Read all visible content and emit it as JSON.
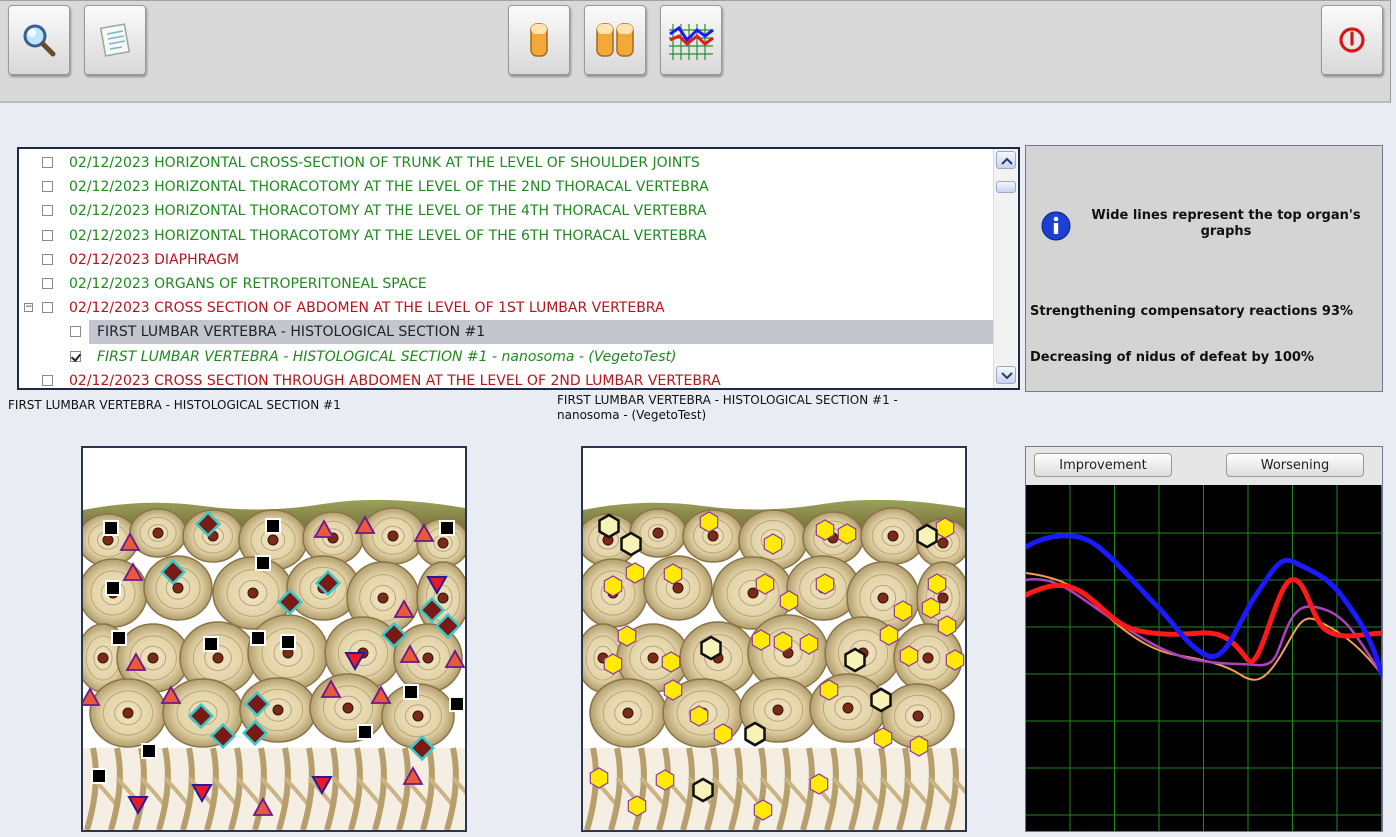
{
  "toolbar": {
    "buttons": [
      {
        "name": "search-button",
        "icon": "magnifier-icon"
      },
      {
        "name": "notes-button",
        "icon": "notebook-icon"
      },
      {
        "name": "single-view-button",
        "icon": "single-capsule-icon"
      },
      {
        "name": "compare-view-button",
        "icon": "double-capsule-icon"
      },
      {
        "name": "graph-view-button",
        "icon": "line-graph-icon"
      },
      {
        "name": "power-button",
        "icon": "power-icon"
      }
    ]
  },
  "list": {
    "rows": [
      {
        "text": "02/12/2023  HORIZONTAL CROSS-SECTION OF TRUNK AT THE LEVEL OF SHOULDER JOINTS",
        "color": "green",
        "checked": false
      },
      {
        "text": "02/12/2023  HORIZONTAL THORACOTOMY AT THE LEVEL OF THE 2ND THORACAL VERTEBRA",
        "color": "green",
        "checked": false
      },
      {
        "text": "02/12/2023  HORIZONTAL THORACOTOMY AT THE LEVEL OF THE 4TH THORACAL VERTEBRA",
        "color": "green",
        "checked": false
      },
      {
        "text": "02/12/2023  HORIZONTAL THORACOTOMY AT THE LEVEL OF THE 6TH THORACAL VERTEBRA",
        "color": "green",
        "checked": false
      },
      {
        "text": "02/12/2023  DIAPHRAGM",
        "color": "red",
        "checked": false
      },
      {
        "text": "02/12/2023  ORGANS OF RETROPERITONEAL SPACE",
        "color": "green",
        "checked": false
      },
      {
        "text": "02/12/2023  CROSS SECTION OF ABDOMEN AT THE LEVEL OF 1ST LUMBAR VERTEBRA",
        "color": "red",
        "checked": false
      },
      {
        "text": "FIRST LUMBAR VERTEBRA - HISTOLOGICAL SECTION #1",
        "color": "dark",
        "checked": false
      },
      {
        "text": "FIRST LUMBAR VERTEBRA - HISTOLOGICAL SECTION #1 - nanosoma - (VegetoTest)",
        "color": "italic-green",
        "checked": true
      },
      {
        "text": "02/12/2023  CROSS SECTION THROUGH ABDOMEN AT THE LEVEL OF 2ND LUMBAR VERTEBRA",
        "color": "red",
        "checked": false
      }
    ],
    "expander_symbol": "−"
  },
  "info": {
    "heading": "Wide lines represent the top organ's graphs",
    "reactions": "Strengthening compensatory reactions 93%",
    "decreasing": "Decreasing of nidus of defeat by 100%"
  },
  "captions": {
    "left": "FIRST LUMBAR VERTEBRA - HISTOLOGICAL SECTION #1",
    "right": "FIRST LUMBAR VERTEBRA - HISTOLOGICAL SECTION #1 - nanosoma - (VegetoTest)"
  },
  "graph": {
    "improvement_label": "Improvement",
    "worsening_label": "Worsening",
    "series_colors": {
      "blue": "#1a1aff",
      "red": "#ff1a1a",
      "magenta": "#b040c0",
      "orange": "#f0a050"
    }
  },
  "colors": {
    "green": "#1e8a1e",
    "red": "#b8141a",
    "grid": "#1e8a1e"
  }
}
